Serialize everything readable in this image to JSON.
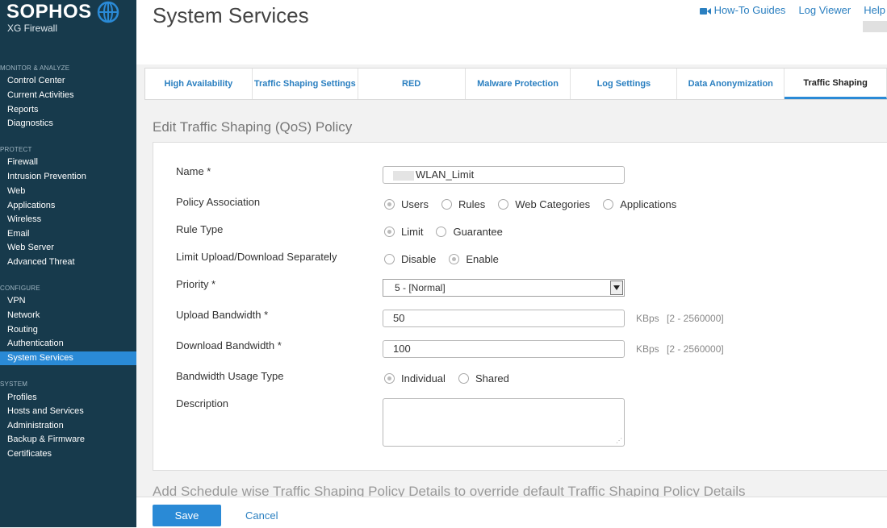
{
  "brand": {
    "logo_text": "SOPHOS",
    "product": "XG Firewall"
  },
  "sidebar": {
    "sections": [
      {
        "title": "MONITOR & ANALYZE",
        "items": [
          "Control Center",
          "Current Activities",
          "Reports",
          "Diagnostics"
        ]
      },
      {
        "title": "PROTECT",
        "items": [
          "Firewall",
          "Intrusion Prevention",
          "Web",
          "Applications",
          "Wireless",
          "Email",
          "Web Server",
          "Advanced Threat"
        ]
      },
      {
        "title": "CONFIGURE",
        "items": [
          "VPN",
          "Network",
          "Routing",
          "Authentication",
          "System Services"
        ]
      },
      {
        "title": "SYSTEM",
        "items": [
          "Profiles",
          "Hosts and Services",
          "Administration",
          "Backup & Firmware",
          "Certificates"
        ]
      }
    ],
    "active_item": "System Services"
  },
  "header": {
    "title": "System Services",
    "links": {
      "howto": "How-To Guides",
      "logviewer": "Log Viewer",
      "help": "Help"
    }
  },
  "tabs": [
    "High Availability",
    "Traffic Shaping Settings",
    "RED",
    "Malware Protection",
    "Log Settings",
    "Data Anonymization",
    "Traffic Shaping"
  ],
  "active_tab": "Traffic Shaping",
  "form": {
    "heading": "Edit Traffic Shaping (QoS) Policy",
    "name": {
      "label": "Name *",
      "value": "WLAN_Limit"
    },
    "policy_association": {
      "label": "Policy Association",
      "options": [
        "Users",
        "Rules",
        "Web Categories",
        "Applications"
      ],
      "selected": "Users"
    },
    "rule_type": {
      "label": "Rule Type",
      "options": [
        "Limit",
        "Guarantee"
      ],
      "selected": "Limit"
    },
    "limit_separately": {
      "label": "Limit Upload/Download Separately",
      "options": [
        "Disable",
        "Enable"
      ],
      "selected": "Enable"
    },
    "priority": {
      "label": "Priority *",
      "value": "5 - [Normal]"
    },
    "upload": {
      "label": "Upload Bandwidth *",
      "value": "50",
      "unit": "KBps",
      "range": "[2 - 2560000]"
    },
    "download": {
      "label": "Download Bandwidth *",
      "value": "100",
      "unit": "KBps",
      "range": "[2 - 2560000]"
    },
    "usage_type": {
      "label": "Bandwidth Usage Type",
      "options": [
        "Individual",
        "Shared"
      ],
      "selected": "Individual"
    },
    "description": {
      "label": "Description",
      "value": ""
    }
  },
  "schedule_heading": "Add Schedule wise Traffic Shaping Policy Details to override default Traffic Shaping Policy Details",
  "footer": {
    "save": "Save",
    "cancel": "Cancel"
  },
  "colors": {
    "sidebar_bg": "#173a4c",
    "accent": "#2a8ad6",
    "link": "#2a7fc0"
  }
}
